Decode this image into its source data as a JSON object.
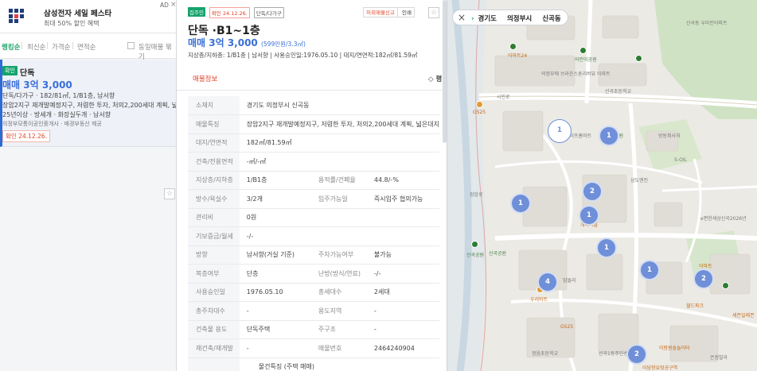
{
  "ad": {
    "title": "삼성전자 세일 페스타",
    "subtitle": "최대 50% 할인 혜택",
    "tag": "AD",
    "close": "×"
  },
  "sort": {
    "items": [
      "랭킹순",
      "최신순",
      "가격순",
      "면적순"
    ],
    "same_building": "동일매물 묶기"
  },
  "card": {
    "badge": "확인",
    "type": "단독",
    "price": "매매 3억 3,000",
    "line1": "단독/다가구 · 182/81㎡, 1/B1층, 남서향",
    "line2": "장암2지구 재개발예정지구, 저렴한 투자, 처의2,200세대 계획, 넓은…",
    "line3": "25년이상 · 방세개 · 화장실두개 · 남서향",
    "line4": "의정부모퉁이공인중개사 · 매경부동산 제공",
    "date": "확인 24.12.26."
  },
  "detail": {
    "tag_new": "집주인",
    "tag_confirm": "확인 24.12.26.",
    "tag_type": "단독/다가구",
    "report": "허위매물신고",
    "print": "인쇄",
    "title": "단독 ·B1~1층",
    "price": "매매 3억 3,000",
    "price_per": "(599만원/3.3㎡)",
    "summary": "지상층/지하층: 1/B1층 | 남서향 | 사용승인일:1976.05.10 | 대지/연면적:182㎡/81.59㎡",
    "tab_info": "매물정보",
    "tab_right": "◇ 평",
    "rows": [
      {
        "k": "소재지",
        "v": "경기도 의정부시 신곡동"
      },
      {
        "k": "매물특징",
        "v": "장암2지구 재개발예정지구, 저렴한 투자, 처의2,200세대 계획, 넓은대지"
      },
      {
        "k": "대지/연면적",
        "v": "182㎡/81.59㎡"
      },
      {
        "k": "건축/전용면적",
        "v": "-㎡/-㎡"
      },
      {
        "k": "지상층/지하층",
        "v": "1/B1층",
        "k2": "용적률/건폐율",
        "v2": "44.8/-%"
      },
      {
        "k": "방수/욕실수",
        "v": "3/2개",
        "k2": "입주가능일",
        "v2": "즉시입주 협의가능"
      },
      {
        "k": "관리비",
        "v": "0원"
      },
      {
        "k": "기보증금/월세",
        "v": "-/-"
      },
      {
        "k": "방향",
        "v": "남서향(거실 기준)",
        "k2": "주차가능여부",
        "v2": "불가능"
      },
      {
        "k": "복층여부",
        "v": "단층",
        "k2": "난방(방식/연료)",
        "v2": "-/-"
      },
      {
        "k": "사용승인일",
        "v": "1976.05.10",
        "k2": "총세대수",
        "v2": "2세대"
      },
      {
        "k": "총주차대수",
        "v": "-",
        "k2": "용도지역",
        "v2": "-"
      },
      {
        "k": "건축물 용도",
        "v": "단독주택",
        "k2": "주구조",
        "v2": "-"
      },
      {
        "k": "재건축/재개발",
        "v": "-",
        "k2": "매물번호",
        "v2": "2464240904"
      }
    ],
    "section_next": "물건특징 (주택 매매)"
  },
  "map": {
    "close": "×",
    "crumbs": [
      "경기도",
      "의정부시",
      "신곡동"
    ],
    "clusters": [
      "1",
      "1",
      "2",
      "1",
      "1",
      "1",
      "4",
      "1",
      "2",
      "2"
    ],
    "labels": [
      "이마트24",
      "어린이공원",
      "의정부에 브라운스톤리버뷰 아파트",
      "신곡초등학교",
      "신곡동 우미린아파트",
      "시민로",
      "GS25",
      "세이프홈마트",
      "공원",
      "방동취사처",
      "삼도엔진",
      "S-OIL",
      "개미마을",
      "신곡공원",
      "신곡공원",
      "e편한세상신곡2026년",
      "이마트",
      "맘돌리",
      "우리마트",
      "GS25",
      "세븐일레븐",
      "정음초등학교",
      "이랑원숲놀이터",
      "신곡1동주민센터",
      "이담향유텃공구역",
      "은정빌라",
      "월드파크",
      "장암로"
    ]
  }
}
